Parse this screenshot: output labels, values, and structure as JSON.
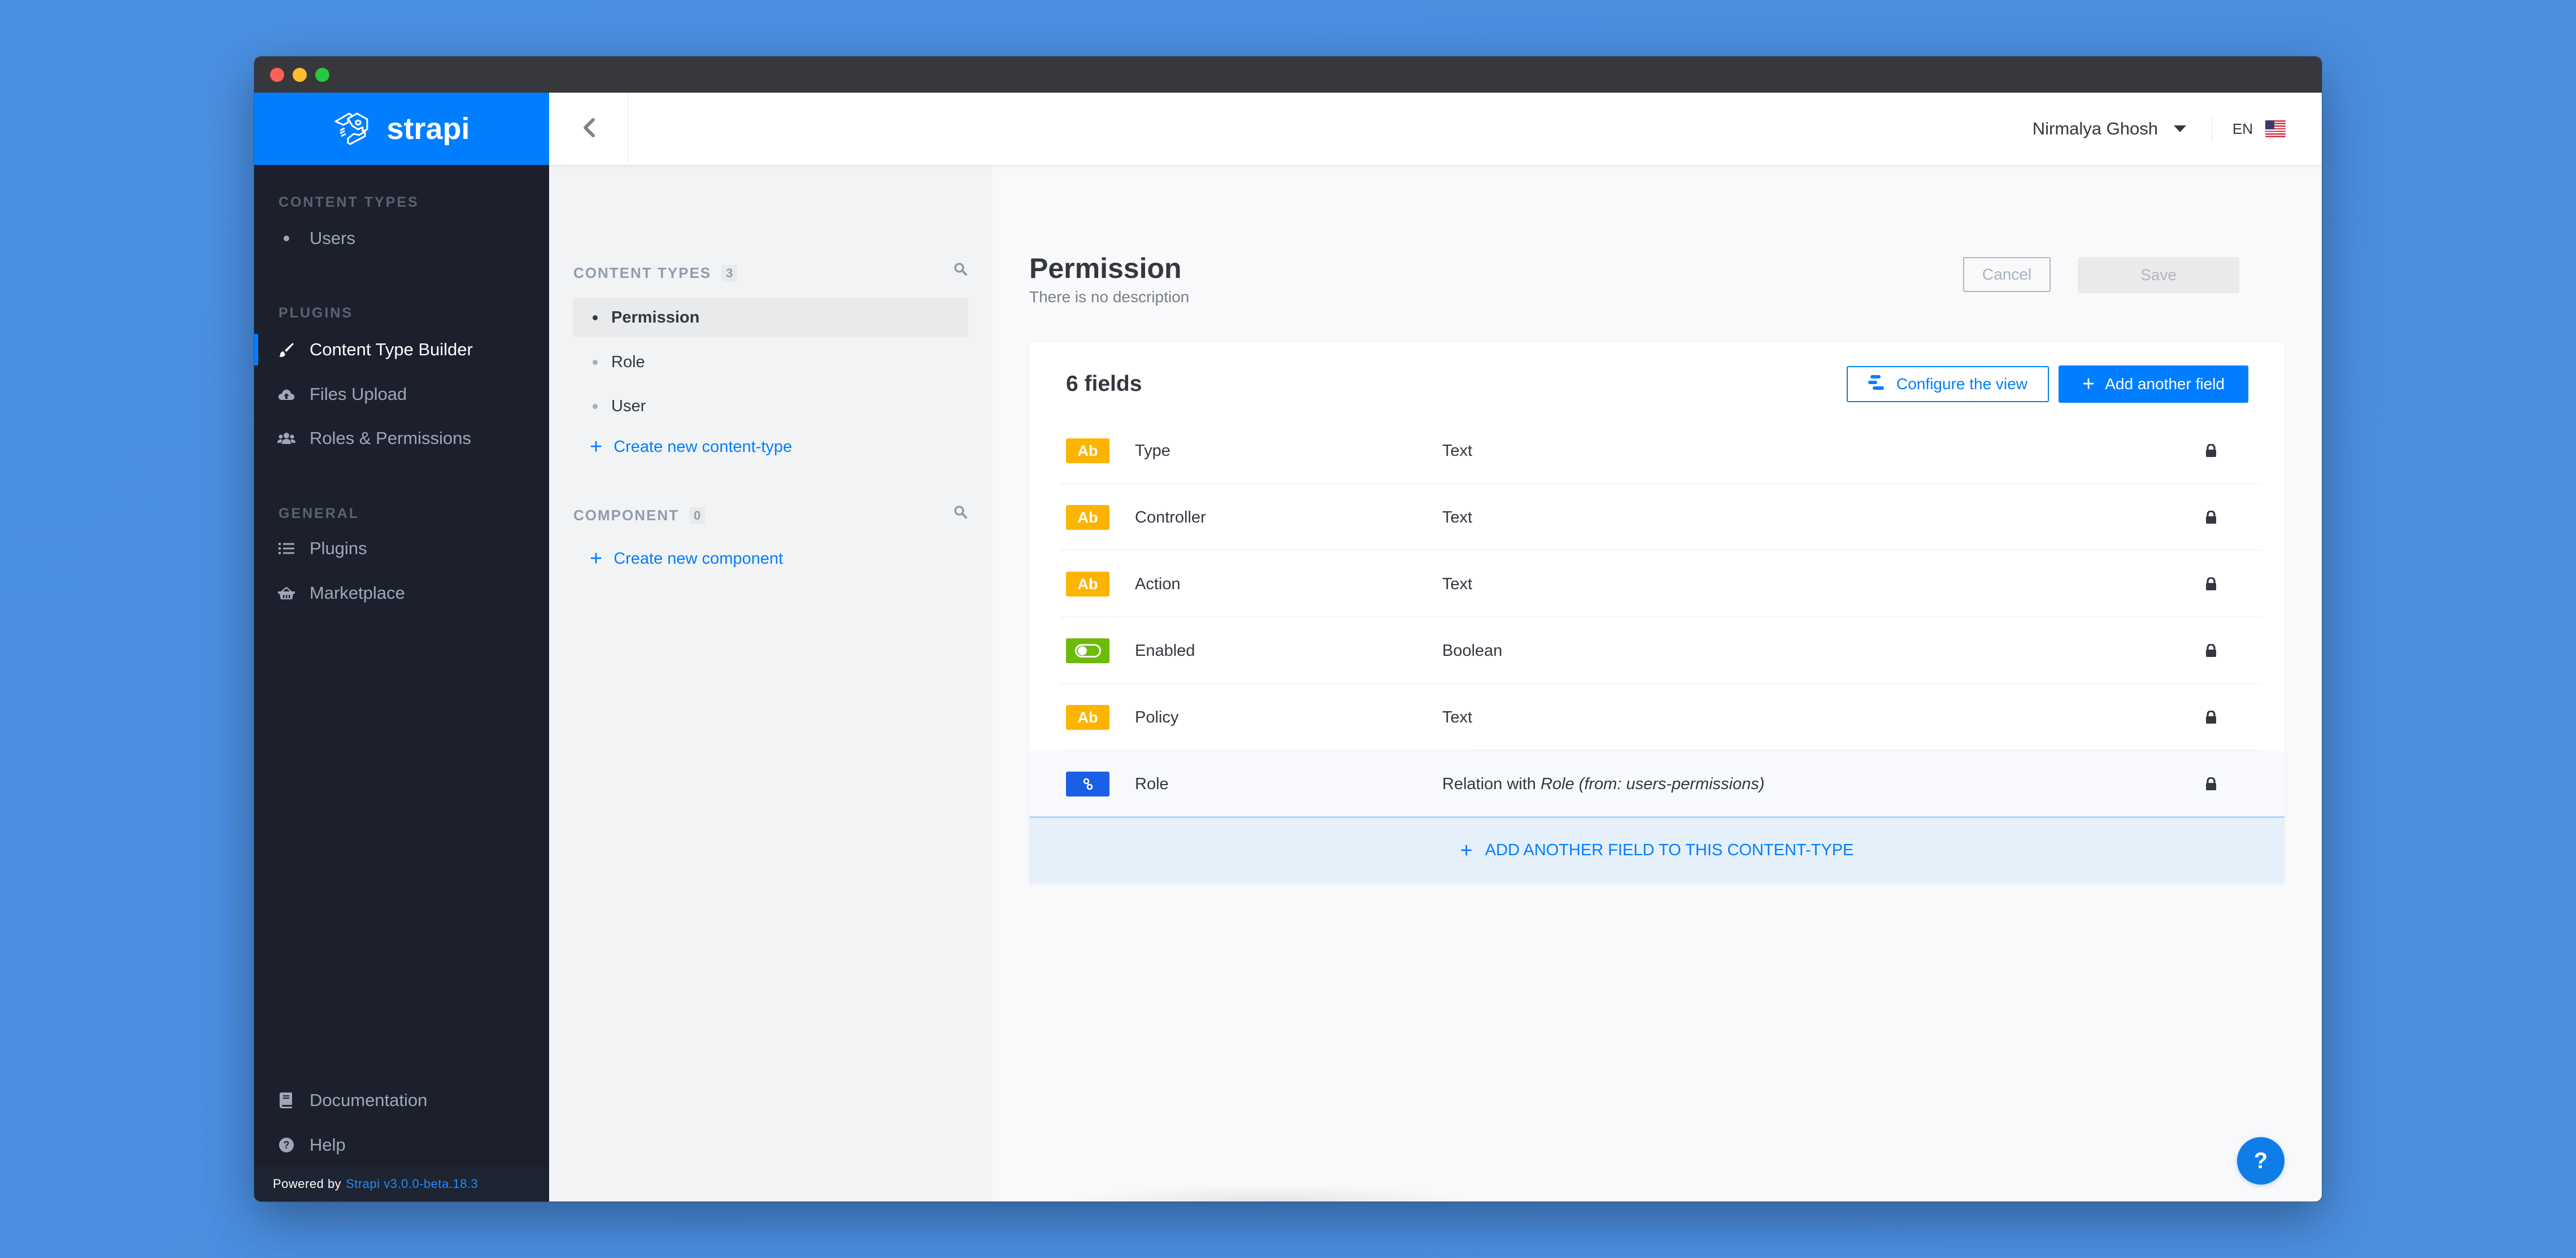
{
  "brand": {
    "name": "strapi",
    "color": "#007eff"
  },
  "sidebar": {
    "sections": [
      {
        "title": "Content Types",
        "items": [
          {
            "label": "Users",
            "icon": "dot-icon",
            "active": false
          }
        ]
      },
      {
        "title": "Plugins",
        "items": [
          {
            "label": "Content Type Builder",
            "icon": "paint-brush-icon",
            "active": true
          },
          {
            "label": "Files Upload",
            "icon": "cloud-upload-icon",
            "active": false
          },
          {
            "label": "Roles & Permissions",
            "icon": "users-icon",
            "active": false
          }
        ]
      },
      {
        "title": "General",
        "items": [
          {
            "label": "Plugins",
            "icon": "list-icon",
            "active": false
          },
          {
            "label": "Marketplace",
            "icon": "shopping-basket-icon",
            "active": false
          }
        ]
      }
    ],
    "bottom_items": [
      {
        "label": "Documentation",
        "icon": "book-icon"
      },
      {
        "label": "Help",
        "icon": "question-circle-icon"
      }
    ],
    "footer": {
      "prefix": "Powered by",
      "version": "Strapi v3.0.0-beta.18.3"
    }
  },
  "header": {
    "user_name": "Nirmalya Ghosh",
    "language": "EN"
  },
  "content_panel": {
    "content_types": {
      "title": "Content Types",
      "count": "3",
      "items": [
        {
          "label": "Permission",
          "active": true
        },
        {
          "label": "Role",
          "active": false
        },
        {
          "label": "User",
          "active": false
        }
      ],
      "create_label": "Create new content-type"
    },
    "components": {
      "title": "Component",
      "count": "0",
      "create_label": "Create new component"
    }
  },
  "main": {
    "title": "Permission",
    "description": "There is no description",
    "cancel_label": "Cancel",
    "save_label": "Save",
    "fields_count_label": "6 fields",
    "configure_label": "Configure the view",
    "add_field_label": "Add another field",
    "fields": [
      {
        "badge": "Ab",
        "kind": "text",
        "name": "Type",
        "type": "Text"
      },
      {
        "badge": "Ab",
        "kind": "text",
        "name": "Controller",
        "type": "Text"
      },
      {
        "badge": "Ab",
        "kind": "text",
        "name": "Action",
        "type": "Text"
      },
      {
        "badge": "",
        "kind": "boolean",
        "name": "Enabled",
        "type": "Boolean"
      },
      {
        "badge": "Ab",
        "kind": "text",
        "name": "Policy",
        "type": "Text"
      },
      {
        "badge": "",
        "kind": "relation",
        "name": "Role",
        "type_prefix": "Relation with ",
        "type_italic": "Role (from: users-permissions)"
      }
    ],
    "add_footer_label": "ADD ANOTHER FIELD TO THIS CONTENT-TYPE",
    "help_label": "?"
  },
  "colors": {
    "primary": "#007eff",
    "text_badge": "#fdb400",
    "boolean_badge": "#6cbb09",
    "relation_badge": "#1a5fe6",
    "sidebar_bg": "#1b202c"
  }
}
